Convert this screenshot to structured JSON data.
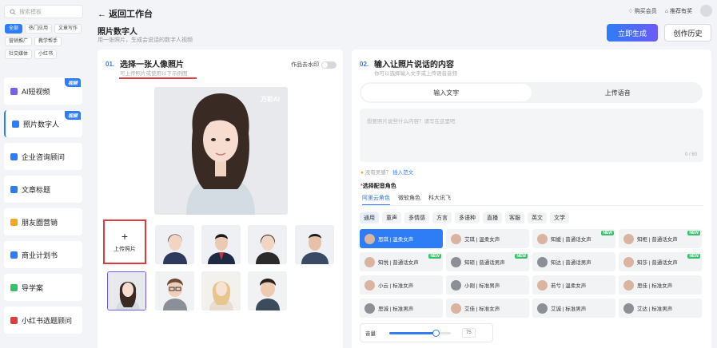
{
  "sidebar": {
    "search_placeholder": "搜索模板",
    "tags": [
      {
        "label": "全部",
        "active": true
      },
      {
        "label": "热门应用",
        "active": false
      },
      {
        "label": "文章写作",
        "active": false
      },
      {
        "label": "营销推广",
        "active": false
      },
      {
        "label": "教学帮手",
        "active": false
      },
      {
        "label": "社交媒体",
        "active": false
      },
      {
        "label": "小红书",
        "active": false
      }
    ],
    "items": [
      {
        "label": "AI短视频",
        "badge": "视频",
        "icon": "ai-video-icon",
        "color": "#7b5cf5"
      },
      {
        "label": "照片数字人",
        "badge": "视频",
        "icon": "digital-human-icon",
        "color": "#2e7df6"
      },
      {
        "label": "企业咨询顾问",
        "badge": "",
        "icon": "consultant-icon",
        "color": "#2e7df6"
      },
      {
        "label": "文章标题",
        "badge": "",
        "icon": "article-title-icon",
        "color": "#2e7df6"
      },
      {
        "label": "朋友圈营销",
        "badge": "",
        "icon": "moments-icon",
        "color": "#f5a623"
      },
      {
        "label": "商业计划书",
        "badge": "",
        "icon": "business-plan-icon",
        "color": "#2e7df6"
      },
      {
        "label": "导学案",
        "badge": "",
        "icon": "study-guide-icon",
        "color": "#37c26a"
      },
      {
        "label": "小红书选题顾问",
        "badge": "",
        "icon": "xiaohongshu-icon",
        "color": "#e23b3b"
      }
    ]
  },
  "header": {
    "back_label": "返回工作台",
    "buy_member": "购买会员",
    "recommend": "推荐有奖",
    "title": "照片数字人",
    "subtitle": "用一张照片，生成会说话的数字人视频",
    "generate_button": "立即生成",
    "history_button": "创作历史"
  },
  "panel1": {
    "step": "01.",
    "title": "选择一张人像照片",
    "subtitle": "可上传照片或使用以下示例图",
    "watermark_label": "作品去水印",
    "preview_watermark": "万彩AI",
    "upload_label": "上传照片",
    "upload_plus": "+"
  },
  "panel2": {
    "step": "02.",
    "title": "输入让照片说话的内容",
    "subtitle": "你可以选择输入文字或上传语音音频",
    "tab_text": "输入文字",
    "tab_voice": "上传语音",
    "textarea_placeholder": "想要照片说些什么内容？请写在这里吧",
    "char_count": "0 / 60",
    "hint_text": "没有灵感？",
    "hint_link": "插入范文",
    "voice_section": "选择配音角色",
    "source_tabs": [
      "阿里云角色",
      "微软角色",
      "科大讯飞"
    ],
    "categories": [
      "通用",
      "童声",
      "多情感",
      "方言",
      "多语种",
      "直播",
      "客服",
      "英文",
      "文学"
    ],
    "voices": [
      {
        "name": "思琪 | 温柔女声",
        "gender": "f",
        "new": false,
        "selected": true
      },
      {
        "name": "艾琪 | 温柔女声",
        "gender": "f",
        "new": false,
        "selected": false
      },
      {
        "name": "知媛 | 普通话女声",
        "gender": "f",
        "new": true,
        "selected": false
      },
      {
        "name": "知柜 | 普通话女声",
        "gender": "f",
        "new": true,
        "selected": false
      },
      {
        "name": "知悦 | 普通话女声",
        "gender": "f",
        "new": true,
        "selected": false
      },
      {
        "name": "知硕 | 普通话男声",
        "gender": "m",
        "new": true,
        "selected": false
      },
      {
        "name": "知达 | 普通话男声",
        "gender": "m",
        "new": false,
        "selected": false
      },
      {
        "name": "知莎 | 普通话女声",
        "gender": "f",
        "new": true,
        "selected": false
      },
      {
        "name": "小云 | 标准女声",
        "gender": "f",
        "new": false,
        "selected": false
      },
      {
        "name": "小刚 | 标准男声",
        "gender": "m",
        "new": false,
        "selected": false
      },
      {
        "name": "若兮 | 温柔女声",
        "gender": "f",
        "new": false,
        "selected": false
      },
      {
        "name": "思佳 | 标准女声",
        "gender": "f",
        "new": false,
        "selected": false
      },
      {
        "name": "思诚 | 标准男声",
        "gender": "m",
        "new": false,
        "selected": false
      },
      {
        "name": "艾佳 | 标准女声",
        "gender": "f",
        "new": false,
        "selected": false
      },
      {
        "name": "艾诚 | 标准男声",
        "gender": "m",
        "new": false,
        "selected": false
      },
      {
        "name": "艾达 | 标准男声",
        "gender": "m",
        "new": false,
        "selected": false
      }
    ],
    "volume_label": "音量",
    "volume_value": "75",
    "volume_fraction": 0.75
  }
}
